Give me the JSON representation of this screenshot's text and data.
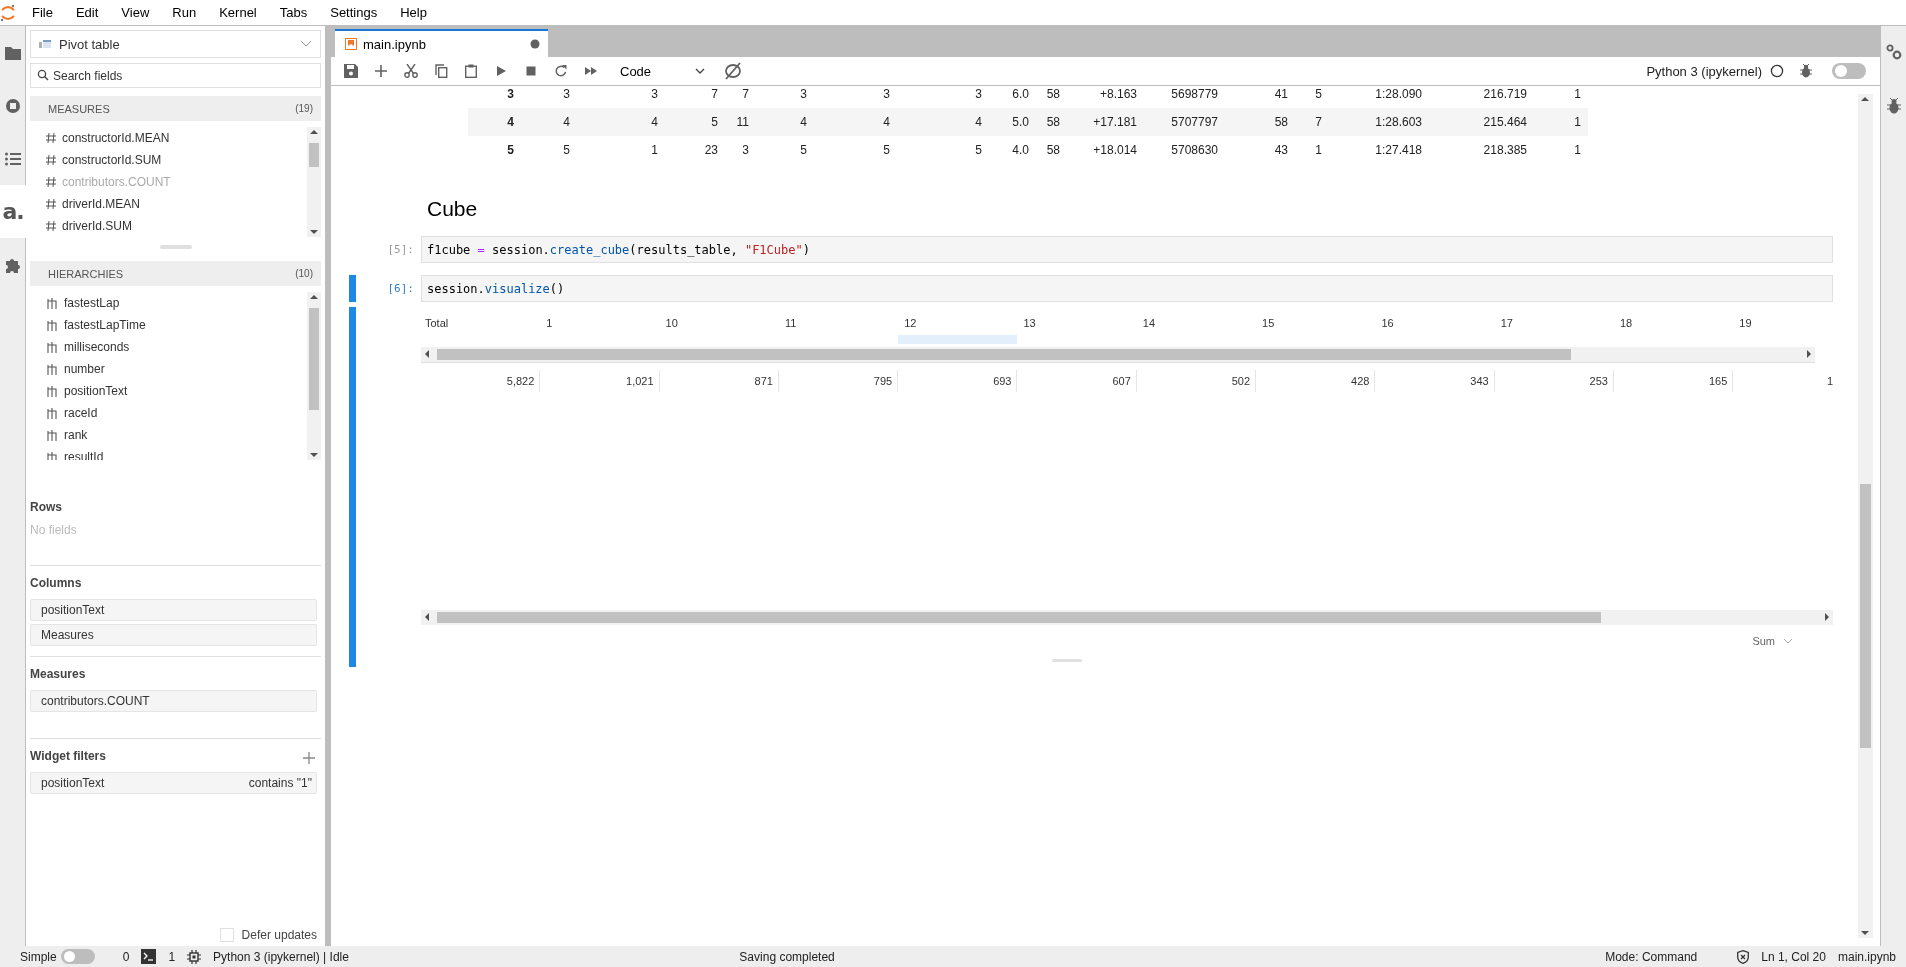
{
  "menu_bar": {
    "items": [
      "File",
      "Edit",
      "View",
      "Run",
      "Kernel",
      "Tabs",
      "Settings",
      "Help"
    ]
  },
  "left_rail": {
    "tabs": [
      {
        "kind": "folder",
        "selected": false
      },
      {
        "kind": "running",
        "selected": false
      },
      {
        "kind": "toc",
        "selected": false
      },
      {
        "kind": "logo",
        "label": "a.",
        "selected": true
      },
      {
        "kind": "extensions",
        "selected": false
      }
    ]
  },
  "pivot_panel": {
    "view_selector": "Pivot table",
    "search": {
      "placeholder": "Search fields"
    },
    "measures": {
      "title": "MEASURES",
      "count": "(19)",
      "items": [
        {
          "label": "constructorId.MEAN",
          "disabled": false
        },
        {
          "label": "constructorId.SUM",
          "disabled": false
        },
        {
          "label": "contributors.COUNT",
          "disabled": true
        },
        {
          "label": "driverId.MEAN",
          "disabled": false
        },
        {
          "label": "driverId.SUM",
          "disabled": false
        }
      ]
    },
    "hierarchies": {
      "title": "HIERARCHIES",
      "count": "(10)",
      "items": [
        "fastestLap",
        "fastestLapTime",
        "milliseconds",
        "number",
        "positionText",
        "raceId",
        "rank",
        "resultId"
      ]
    },
    "rows": {
      "title": "Rows",
      "empty_text": "No fields"
    },
    "columns": {
      "title": "Columns",
      "fields": [
        "positionText",
        "Measures"
      ]
    },
    "measures_section": {
      "title": "Measures",
      "fields": [
        "contributors.COUNT"
      ]
    },
    "widget_filters": {
      "title": "Widget filters",
      "filters": [
        {
          "field": "positionText",
          "condition": "contains \"1\""
        }
      ]
    },
    "defer_updates": {
      "label": "Defer updates",
      "checked": false
    }
  },
  "notebook": {
    "tab": {
      "title": "main.ipynb",
      "dirty": true,
      "selected": true
    },
    "toolbar": {
      "cell_type": "Code",
      "kernel_name": "Python 3 (ipykernel)",
      "kernel_busy": false,
      "debugger_on": false
    },
    "table": {
      "rows": [
        [
          "3",
          "3",
          "3",
          "7",
          "7",
          "3",
          "3",
          "3",
          "6.0",
          "58",
          "+8.163",
          "5698779",
          "41",
          "5",
          "1:28.090",
          "216.719",
          "1"
        ],
        [
          "4",
          "4",
          "4",
          "5",
          "11",
          "4",
          "4",
          "4",
          "5.0",
          "58",
          "+17.181",
          "5707797",
          "58",
          "7",
          "1:28.603",
          "215.464",
          "1"
        ],
        [
          "5",
          "5",
          "1",
          "23",
          "3",
          "5",
          "5",
          "5",
          "4.0",
          "58",
          "+18.014",
          "5708630",
          "43",
          "1",
          "1:27.418",
          "218.385",
          "1"
        ]
      ]
    },
    "heading": "Cube",
    "cells": [
      {
        "prompt": "[5]:",
        "active": false,
        "tokens": [
          {
            "text": "f1cube ",
            "kind": "name"
          },
          {
            "text": "=",
            "kind": "op"
          },
          {
            "text": " session.",
            "kind": "name"
          },
          {
            "text": "create_cube",
            "kind": "func"
          },
          {
            "text": "(results_table, ",
            "kind": "name"
          },
          {
            "text": "\"F1Cube\"",
            "kind": "string"
          },
          {
            "text": ")",
            "kind": "name"
          }
        ]
      },
      {
        "prompt": "[6]:",
        "active": true,
        "tokens": [
          {
            "text": "session.",
            "kind": "name"
          },
          {
            "text": "visualize",
            "kind": "func"
          },
          {
            "text": "()",
            "kind": "name"
          }
        ]
      }
    ],
    "pivot_output": {
      "headers": [
        {
          "label": "Total",
          "highlighted": false
        },
        {
          "label": "1",
          "highlighted": false
        },
        {
          "label": "10",
          "highlighted": false
        },
        {
          "label": "11",
          "highlighted": false
        },
        {
          "label": "12",
          "highlighted": true
        },
        {
          "label": "13",
          "highlighted": false
        },
        {
          "label": "14",
          "highlighted": false
        },
        {
          "label": "15",
          "highlighted": false
        },
        {
          "label": "16",
          "highlighted": false
        },
        {
          "label": "17",
          "highlighted": false
        },
        {
          "label": "18",
          "highlighted": false
        },
        {
          "label": "19",
          "highlighted": false
        }
      ],
      "values": [
        "5,822",
        "1,021",
        "871",
        "795",
        "693",
        "607",
        "502",
        "428",
        "343",
        "253",
        "165",
        "1"
      ],
      "aggregation": "Sum"
    }
  },
  "status_bar": {
    "simple_label": "Simple",
    "simple_mode": false,
    "terminals": "0",
    "kernels": "1",
    "kernel_status": "Python 3 (ipykernel) | Idle",
    "message": "Saving completed",
    "mode": "Mode: Command",
    "cursor": "Ln 1, Col 20",
    "file": "main.ipynb"
  }
}
